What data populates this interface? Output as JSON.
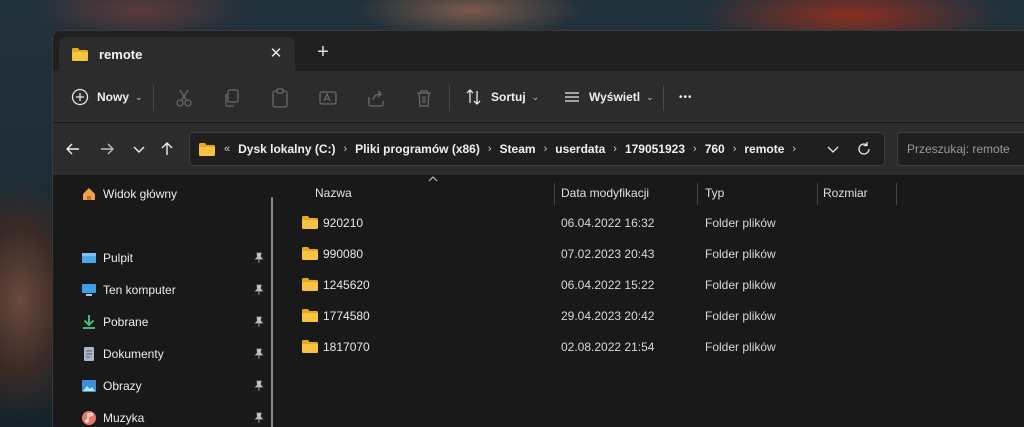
{
  "tab": {
    "title": "remote",
    "close_glyph": "✕",
    "new_tab_glyph": "+"
  },
  "toolbar": {
    "new_label": "Nowy",
    "sort_label": "Sortuj",
    "view_label": "Wyświetl",
    "more_glyph": "•••",
    "icons": [
      "cut-icon",
      "copy-icon",
      "paste-icon",
      "rename-icon",
      "share-icon",
      "delete-icon"
    ]
  },
  "address": {
    "overflow": "«",
    "crumbs": [
      "Dysk lokalny (C:)",
      "Pliki programów (x86)",
      "Steam",
      "userdata",
      "179051923",
      "760",
      "remote"
    ],
    "separator": "›"
  },
  "search": {
    "placeholder": "Przeszukaj: remote"
  },
  "sidebar": {
    "home_label": "Widok główny",
    "items": [
      {
        "label": "Pulpit",
        "icon": "desktop-icon"
      },
      {
        "label": "Ten komputer",
        "icon": "computer-icon"
      },
      {
        "label": "Pobrane",
        "icon": "download-icon"
      },
      {
        "label": "Dokumenty",
        "icon": "documents-icon"
      },
      {
        "label": "Obrazy",
        "icon": "pictures-icon"
      },
      {
        "label": "Muzyka",
        "icon": "music-icon"
      }
    ]
  },
  "columns": {
    "name": "Nazwa",
    "modified": "Data modyfikacji",
    "type": "Typ",
    "size": "Rozmiar"
  },
  "files": [
    {
      "name": "920210",
      "modified": "06.04.2022 16:32",
      "type": "Folder plików"
    },
    {
      "name": "990080",
      "modified": "07.02.2023 20:43",
      "type": "Folder plików"
    },
    {
      "name": "1245620",
      "modified": "06.04.2022 15:22",
      "type": "Folder plików"
    },
    {
      "name": "1774580",
      "modified": "29.04.2023 20:42",
      "type": "Folder plików"
    },
    {
      "name": "1817070",
      "modified": "02.08.2022 21:54",
      "type": "Folder plików"
    }
  ],
  "colors": {
    "folder": "#f6c343",
    "accent": "#4cc2ff",
    "window_bg": "#191919",
    "bar_bg": "#2c2c2c"
  }
}
